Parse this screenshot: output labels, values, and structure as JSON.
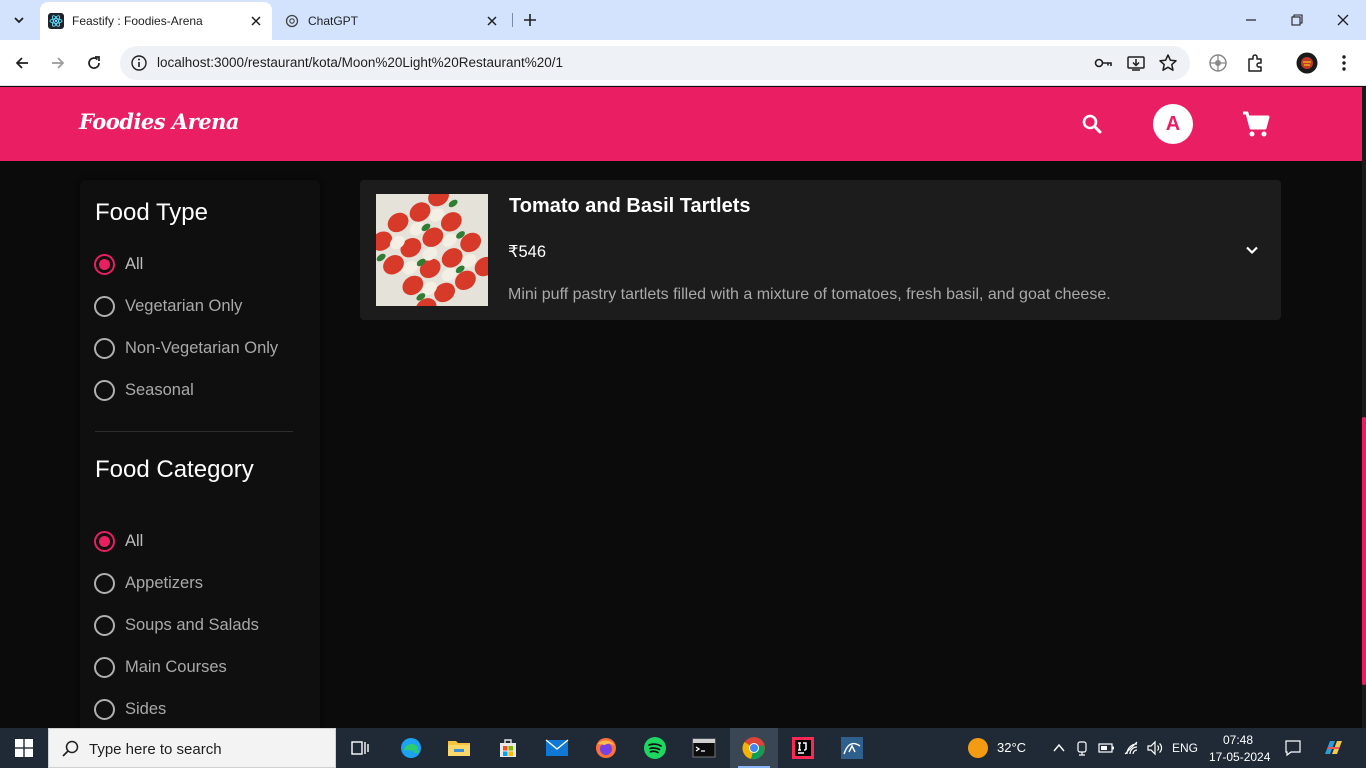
{
  "browser": {
    "tabs": [
      {
        "title": "Feastify : Foodies-Arena",
        "active": true
      },
      {
        "title": "ChatGPT",
        "active": false
      }
    ],
    "url": "localhost:3000/restaurant/kota/Moon%20Light%20Restaurant%20/1"
  },
  "header": {
    "logo": "Foodies Arena",
    "avatar_initial": "A",
    "brand_color": "#e91e63"
  },
  "sidebar": {
    "food_type": {
      "title": "Food Type",
      "options": [
        {
          "label": "All",
          "checked": true
        },
        {
          "label": "Vegetarian Only",
          "checked": false
        },
        {
          "label": "Non-Vegetarian Only",
          "checked": false
        },
        {
          "label": "Seasonal",
          "checked": false
        }
      ]
    },
    "food_category": {
      "title": "Food Category",
      "options": [
        {
          "label": "All",
          "checked": true
        },
        {
          "label": "Appetizers",
          "checked": false
        },
        {
          "label": "Soups and Salads",
          "checked": false
        },
        {
          "label": "Main Courses",
          "checked": false
        },
        {
          "label": "Sides",
          "checked": false
        }
      ]
    }
  },
  "menu_items": [
    {
      "name": "Tomato and Basil Tartlets",
      "price": "₹546",
      "description": "Mini puff pastry tartlets filled with a mixture of tomatoes, fresh basil, and goat cheese."
    }
  ],
  "taskbar": {
    "search_placeholder": "Type here to search",
    "temperature": "32°C",
    "language": "ENG",
    "time": "07:48",
    "date": "17-05-2024"
  }
}
